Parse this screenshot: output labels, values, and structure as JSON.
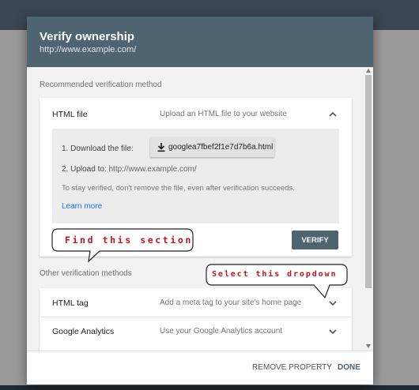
{
  "dialog": {
    "title": "Verify ownership",
    "url": "http://www.example.com/"
  },
  "recommended": {
    "label": "Recommended verification method",
    "html_file": {
      "title": "HTML file",
      "description": "Upload an HTML file to your website",
      "step1_label": "1. Download the file:",
      "download_filename": "googlea7fbef2f1e7d7b6a.html",
      "step2_label": "2. Upload to:",
      "step2_url": "http://www.example.com/",
      "note": "To stay verified, don't remove the file, even after verification succeeds.",
      "learn_more": "Learn more",
      "verify_label": "VERIFY"
    }
  },
  "other": {
    "label": "Other verification methods",
    "methods": [
      {
        "title": "HTML tag",
        "description": "Add a meta tag to your site's home page"
      },
      {
        "title": "Google Analytics",
        "description": "Use your Google Analytics account"
      }
    ]
  },
  "footer": {
    "remove_label": "REMOVE PROPERTY",
    "done_label": "DONE"
  },
  "annotations": {
    "find_section": "Find this section",
    "select_dropdown": "Select this dropdown",
    "color": "#c0141c"
  },
  "colors": {
    "header": "#4e6471",
    "link": "#1a73e8"
  },
  "icons": {
    "download": "download-icon",
    "chevron_up": "chevron-up-icon",
    "chevron_down": "chevron-down-icon"
  }
}
